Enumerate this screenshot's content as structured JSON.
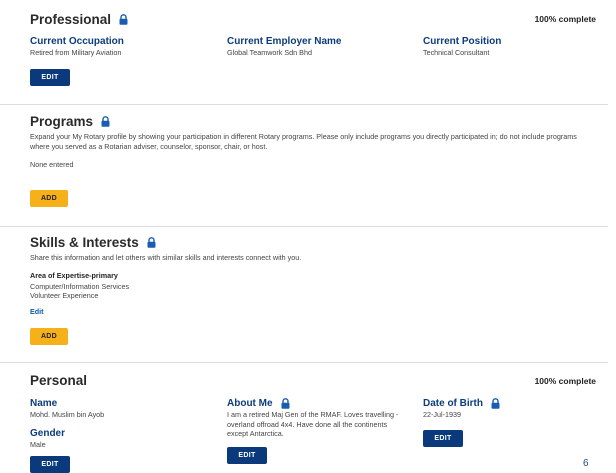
{
  "professional": {
    "title": "Professional",
    "complete": "100% complete",
    "occupation_label": "Current Occupation",
    "occupation_value": "Retired from Military Aviation",
    "employer_label": "Current Employer Name",
    "employer_value": "Global Teamwork Sdn Bhd",
    "position_label": "Current Position",
    "position_value": "Technical Consultant",
    "edit_label": "EDIT"
  },
  "programs": {
    "title": "Programs",
    "description": "Expand your My Rotary profile by showing your participation in different Rotary programs. Please only include programs you directly participated in; do not include programs where you served as a Rotarian adviser, counselor, sponsor, chair, or host.",
    "empty_text": "None entered",
    "add_label": "ADD"
  },
  "skills": {
    "title": "Skills & Interests",
    "description": "Share this information and let others with similar skills and interests connect with you.",
    "area_label": "Area of Expertise-primary",
    "area_value_1": "Computer/Information Services",
    "area_value_2": "Volunteer Experience",
    "edit_link": "Edit",
    "add_label": "ADD"
  },
  "personal": {
    "title": "Personal",
    "complete": "100% complete",
    "name_label": "Name",
    "name_value": "Mohd. Muslim bin Ayob",
    "gender_label": "Gender",
    "gender_value": "Male",
    "about_label": "About Me",
    "about_value": "I am a retired Maj Gen of the RMAF. Loves travelling - overland offroad 4x4. Have done all the continents except Antarctica.",
    "dob_label": "Date of Birth",
    "dob_value": "22-Jul-1939",
    "edit_label": "EDIT"
  },
  "page_number": "6",
  "colors": {
    "navy": "#0a3a7c",
    "gold": "#f5b01a",
    "lock_blue": "#1a5cb0"
  }
}
